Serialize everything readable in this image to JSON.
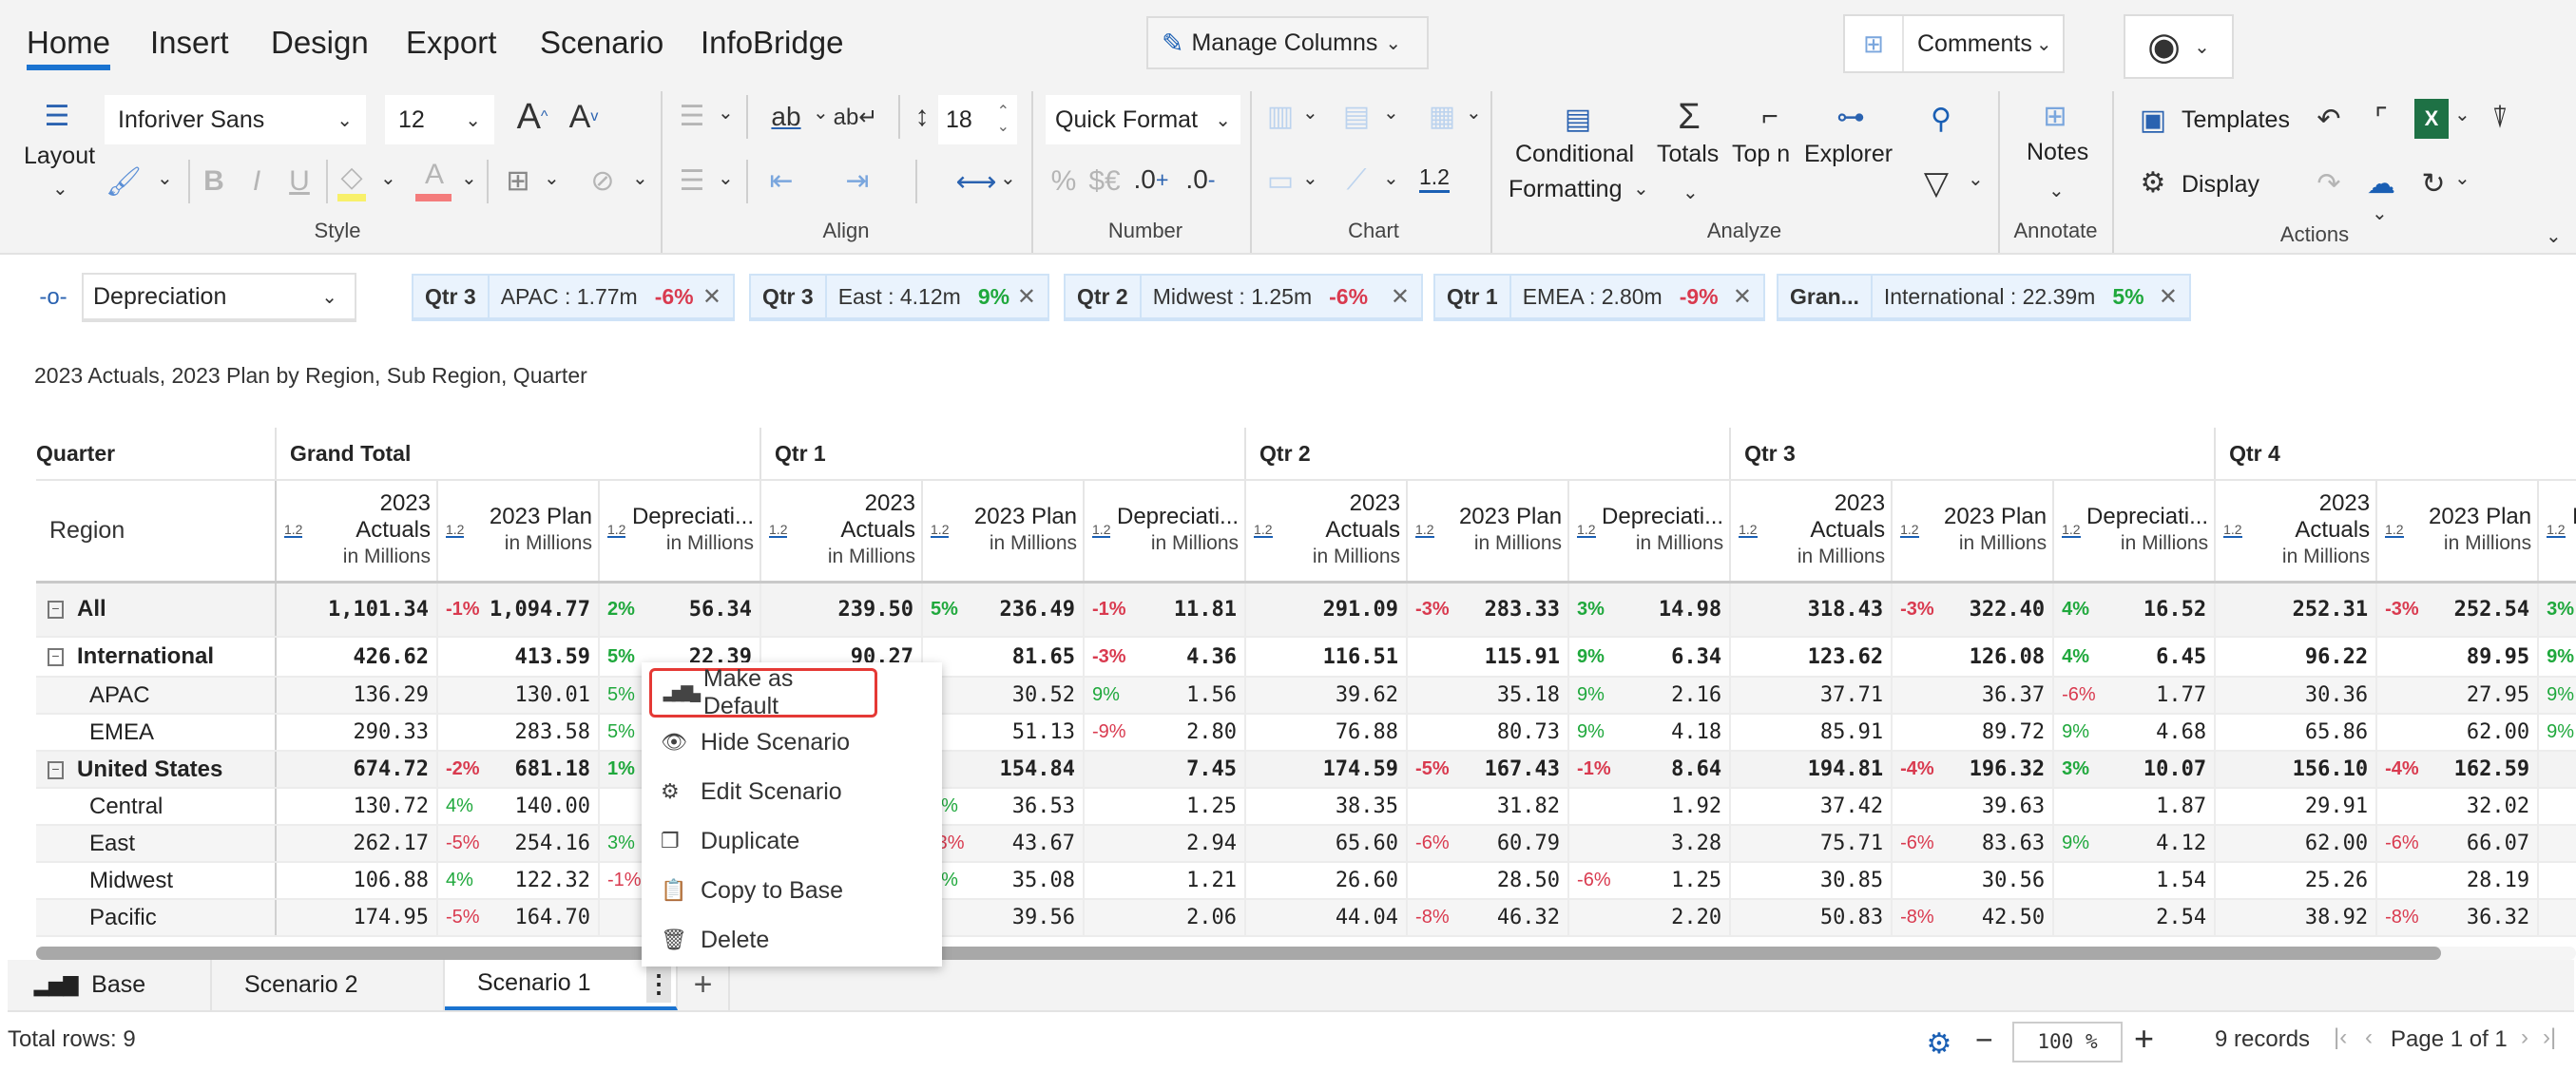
{
  "tabs": [
    "Home",
    "Insert",
    "Design",
    "Export",
    "Scenario",
    "InfoBridge"
  ],
  "active_tab": "Home",
  "manage_columns": "Manage Columns",
  "comments": "Comments",
  "ribbon": {
    "layout": "Layout",
    "font": "Inforiver Sans",
    "font_size": "12",
    "line_height": "18",
    "quick_format": "Quick Format",
    "chart_num": "1.2",
    "conditional": "Conditional",
    "formatting": "Formatting",
    "totals": "Totals",
    "topn": "Top n",
    "explorer": "Explorer",
    "notes": "Notes",
    "templates": "Templates",
    "display": "Display",
    "groups": {
      "style": "Style",
      "align": "Align",
      "number": "Number",
      "chart": "Chart",
      "analyze": "Analyze",
      "annotate": "Annotate",
      "actions": "Actions"
    }
  },
  "filter": {
    "measure": "Depreciation",
    "chips": [
      {
        "key": "Qtr 3",
        "label": "APAC :  1.77m",
        "pct": "-6%"
      },
      {
        "key": "Qtr 3",
        "label": "East :  4.12m",
        "pct": "9%"
      },
      {
        "key": "Qtr 2",
        "label": "Midwest :  1.25m",
        "pct": "-6%"
      },
      {
        "key": "Qtr 1",
        "label": "EMEA :  2.80m",
        "pct": "-9%"
      },
      {
        "key": "Gran...",
        "label": "International :  22.39m",
        "pct": "5%"
      }
    ]
  },
  "report_title": "2023 Actuals, 2023 Plan by Region, Sub Region, Quarter",
  "table": {
    "corner_top": "Quarter",
    "corner_bottom": "Region",
    "groups": [
      "Grand Total",
      "Qtr 1",
      "Qtr 2",
      "Qtr 3",
      "Qtr 4"
    ],
    "measure_icon": "1.2",
    "measures": [
      {
        "l1": "2023",
        "l2": "Actuals",
        "sub": "in Millions"
      },
      {
        "l1": "",
        "l2": "2023 Plan",
        "sub": "in Millions"
      },
      {
        "l1": "",
        "l2": "Depreciati...",
        "sub": "in Millions"
      }
    ],
    "rows": [
      {
        "label": "All",
        "level": 0,
        "bold": true,
        "cells": [
          [
            "",
            "1,101.34"
          ],
          [
            "-1%",
            "1,094.77"
          ],
          [
            "2%",
            "56.34"
          ],
          [
            "",
            "239.50"
          ],
          [
            "5%",
            "236.49"
          ],
          [
            "-1%",
            "11.81"
          ],
          [
            "",
            "291.09"
          ],
          [
            "-3%",
            "283.33"
          ],
          [
            "3%",
            "14.98"
          ],
          [
            "",
            "318.43"
          ],
          [
            "-3%",
            "322.40"
          ],
          [
            "4%",
            "16.52"
          ],
          [
            "",
            "252.31"
          ],
          [
            "-3%",
            "252.54"
          ],
          [
            "3%",
            ""
          ]
        ]
      },
      {
        "label": "International",
        "level": 0,
        "bold": true,
        "cells": [
          [
            "",
            "426.62"
          ],
          [
            "",
            "413.59"
          ],
          [
            "5%",
            "22.39"
          ],
          [
            "",
            "90.27"
          ],
          [
            "",
            "81.65"
          ],
          [
            "-3%",
            "4.36"
          ],
          [
            "",
            "116.51"
          ],
          [
            "",
            "115.91"
          ],
          [
            "9%",
            "6.34"
          ],
          [
            "",
            "123.62"
          ],
          [
            "",
            "126.08"
          ],
          [
            "4%",
            "6.45"
          ],
          [
            "",
            "96.22"
          ],
          [
            "",
            "89.95"
          ],
          [
            "9%",
            ""
          ]
        ]
      },
      {
        "label": "APAC",
        "level": 1,
        "bold": false,
        "cells": [
          [
            "",
            "136.29"
          ],
          [
            "",
            "130.01"
          ],
          [
            "5%",
            ""
          ],
          [
            "",
            ""
          ],
          [
            "",
            "30.52"
          ],
          [
            "9%",
            "1.56"
          ],
          [
            "",
            "39.62"
          ],
          [
            "",
            "35.18"
          ],
          [
            "9%",
            "2.16"
          ],
          [
            "",
            "37.71"
          ],
          [
            "",
            "36.37"
          ],
          [
            "-6%",
            "1.77"
          ],
          [
            "",
            "30.36"
          ],
          [
            "",
            "27.95"
          ],
          [
            "9%",
            ""
          ]
        ]
      },
      {
        "label": "EMEA",
        "level": 1,
        "bold": false,
        "cells": [
          [
            "",
            "290.33"
          ],
          [
            "",
            "283.58"
          ],
          [
            "5%",
            ""
          ],
          [
            "",
            ""
          ],
          [
            "",
            "51.13"
          ],
          [
            "-9%",
            "2.80"
          ],
          [
            "",
            "76.88"
          ],
          [
            "",
            "80.73"
          ],
          [
            "9%",
            "4.18"
          ],
          [
            "",
            "85.91"
          ],
          [
            "",
            "89.72"
          ],
          [
            "9%",
            "4.68"
          ],
          [
            "",
            "65.86"
          ],
          [
            "",
            "62.00"
          ],
          [
            "9%",
            ""
          ]
        ]
      },
      {
        "label": "United States",
        "level": 0,
        "bold": true,
        "cells": [
          [
            "",
            "674.72"
          ],
          [
            "-2%",
            "681.18"
          ],
          [
            "1%",
            ""
          ],
          [
            "",
            ""
          ],
          [
            "",
            "154.84"
          ],
          [
            "",
            "7.45"
          ],
          [
            "",
            "174.59"
          ],
          [
            "-5%",
            "167.43"
          ],
          [
            "-1%",
            "8.64"
          ],
          [
            "",
            "194.81"
          ],
          [
            "-4%",
            "196.32"
          ],
          [
            "3%",
            "10.07"
          ],
          [
            "",
            "156.10"
          ],
          [
            "-4%",
            "162.59"
          ],
          [
            "",
            ""
          ]
        ]
      },
      {
        "label": "Central",
        "level": 1,
        "bold": false,
        "cells": [
          [
            "",
            "130.72"
          ],
          [
            "4%",
            "140.00"
          ],
          [
            "",
            ""
          ],
          [
            "",
            ""
          ],
          [
            "7%",
            "36.53"
          ],
          [
            "",
            "1.25"
          ],
          [
            "",
            "38.35"
          ],
          [
            "",
            "31.82"
          ],
          [
            "",
            "1.92"
          ],
          [
            "",
            "37.42"
          ],
          [
            "",
            "39.63"
          ],
          [
            "",
            "1.87"
          ],
          [
            "",
            "29.91"
          ],
          [
            "",
            "32.02"
          ],
          [
            "",
            ""
          ]
        ]
      },
      {
        "label": "East",
        "level": 1,
        "bold": false,
        "cells": [
          [
            "",
            "262.17"
          ],
          [
            "-5%",
            "254.16"
          ],
          [
            "3%",
            ""
          ],
          [
            "",
            ""
          ],
          [
            "-3%",
            "43.67"
          ],
          [
            "",
            "2.94"
          ],
          [
            "",
            "65.60"
          ],
          [
            "-6%",
            "60.79"
          ],
          [
            "",
            "3.28"
          ],
          [
            "",
            "75.71"
          ],
          [
            "-6%",
            "83.63"
          ],
          [
            "9%",
            "4.12"
          ],
          [
            "",
            "62.00"
          ],
          [
            "-6%",
            "66.07"
          ],
          [
            "",
            ""
          ]
        ]
      },
      {
        "label": "Midwest",
        "level": 1,
        "bold": false,
        "cells": [
          [
            "",
            "106.88"
          ],
          [
            "4%",
            "122.32"
          ],
          [
            "-1%",
            ""
          ],
          [
            "",
            ""
          ],
          [
            "7%",
            "35.08"
          ],
          [
            "",
            "1.21"
          ],
          [
            "",
            "26.60"
          ],
          [
            "",
            "28.50"
          ],
          [
            "-6%",
            "1.25"
          ],
          [
            "",
            "30.85"
          ],
          [
            "",
            "30.56"
          ],
          [
            "",
            "1.54"
          ],
          [
            "",
            "25.26"
          ],
          [
            "",
            "28.19"
          ],
          [
            "",
            ""
          ]
        ]
      },
      {
        "label": "Pacific",
        "level": 1,
        "bold": false,
        "cells": [
          [
            "",
            "174.95"
          ],
          [
            "-5%",
            "164.70"
          ],
          [
            "",
            ""
          ],
          [
            "",
            ""
          ],
          [
            "",
            "39.56"
          ],
          [
            "",
            "2.06"
          ],
          [
            "",
            "44.04"
          ],
          [
            "-8%",
            "46.32"
          ],
          [
            "",
            "2.20"
          ],
          [
            "",
            "50.83"
          ],
          [
            "-8%",
            "42.50"
          ],
          [
            "",
            "2.54"
          ],
          [
            "",
            "38.92"
          ],
          [
            "-8%",
            "36.32"
          ],
          [
            "",
            ""
          ]
        ]
      }
    ]
  },
  "context_menu": [
    {
      "label": "Make as Default",
      "icon": "bar-chart-icon",
      "glyph": "▂▅▇▄"
    },
    {
      "label": "Hide Scenario",
      "icon": "eye-hide-icon",
      "glyph": "👁"
    },
    {
      "label": "Edit Scenario",
      "icon": "gear-icon",
      "glyph": "⚙"
    },
    {
      "label": "Duplicate",
      "icon": "duplicate-icon",
      "glyph": "❐"
    },
    {
      "label": "Copy to Base",
      "icon": "clipboard-icon",
      "glyph": "📋"
    },
    {
      "label": "Delete",
      "icon": "trash-icon",
      "glyph": "🗑"
    }
  ],
  "sheets": {
    "base": "Base",
    "s2": "Scenario 2",
    "s1": "Scenario 1",
    "kebab": "⋮",
    "add": "+"
  },
  "status": {
    "total_rows": "Total rows: 9",
    "zoom": "100 %",
    "records": "9 records",
    "page": "Page 1 of 1"
  },
  "colors": {
    "accent": "#1a73d0",
    "negative": "#d93a4f",
    "positive": "#1fa83c",
    "highlight": "#e53935"
  }
}
